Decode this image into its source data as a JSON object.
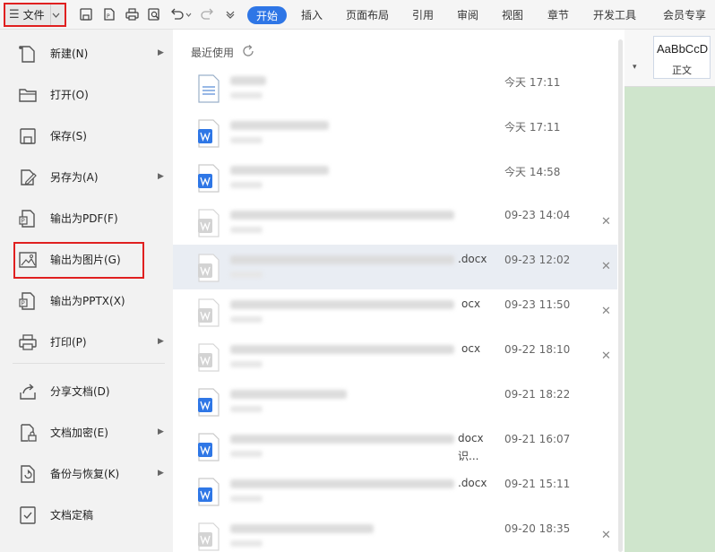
{
  "toolbar": {
    "file_label": "文件",
    "tabs": [
      {
        "label": "开始",
        "active": true
      },
      {
        "label": "插入"
      },
      {
        "label": "页面布局"
      },
      {
        "label": "引用"
      },
      {
        "label": "审阅"
      },
      {
        "label": "视图"
      },
      {
        "label": "章节"
      },
      {
        "label": "开发工具"
      },
      {
        "label": "会员专享"
      }
    ],
    "accent_color": "#2e76e6",
    "quick_access_icons": [
      "save-icon",
      "export-pdf-icon",
      "print-icon",
      "print-preview-icon",
      "undo-icon",
      "redo-icon",
      "more-icon"
    ]
  },
  "style_gallery": {
    "sample": "AaBbCcD",
    "name": "正文"
  },
  "file_menu": {
    "items": [
      {
        "label": "新建(N)",
        "icon": "new-icon",
        "submenu": true
      },
      {
        "label": "打开(O)",
        "icon": "folder-icon",
        "submenu": false
      },
      {
        "label": "保存(S)",
        "icon": "save-icon",
        "submenu": false
      },
      {
        "label": "另存为(A)",
        "icon": "save-as-icon",
        "submenu": true
      },
      {
        "label": "输出为PDF(F)",
        "icon": "export-pdf-icon",
        "submenu": false
      },
      {
        "label": "输出为图片(G)",
        "icon": "image-icon",
        "submenu": false,
        "highlighted": true
      },
      {
        "label": "输出为PPTX(X)",
        "icon": "export-pptx-icon",
        "submenu": false
      },
      {
        "label": "打印(P)",
        "icon": "print-icon",
        "submenu": true
      },
      {
        "label": "分享文档(D)",
        "icon": "share-icon",
        "submenu": false
      },
      {
        "label": "文档加密(E)",
        "icon": "lock-document-icon",
        "submenu": true
      },
      {
        "label": "备份与恢复(K)",
        "icon": "backup-icon",
        "submenu": true
      },
      {
        "label": "文档定稿",
        "icon": "finalize-icon",
        "submenu": false
      }
    ]
  },
  "recent": {
    "title": "最近使用",
    "files": [
      {
        "type": "txt",
        "name_suffix": "",
        "sub": "",
        "time": "今天  17:11",
        "closable": false
      },
      {
        "type": "word",
        "name_suffix": "",
        "sub": "",
        "time": "今天  17:11",
        "closable": false
      },
      {
        "type": "word",
        "name_suffix": "",
        "sub": "",
        "time": "今天  14:58",
        "closable": false
      },
      {
        "type": "word-gray",
        "name_suffix": "",
        "sub": "",
        "time": "09-23 14:04",
        "closable": true
      },
      {
        "type": "word-gray",
        "name_suffix": ".docx",
        "sub": "",
        "time": "09-23 12:02",
        "closable": true,
        "selected": true
      },
      {
        "type": "word-gray",
        "name_suffix": "ocx",
        "sub": "",
        "time": "09-23 11:50",
        "closable": true
      },
      {
        "type": "word-gray",
        "name_suffix": "ocx",
        "sub": "",
        "time": "09-22 18:10",
        "closable": true
      },
      {
        "type": "word",
        "name_suffix": "",
        "sub": "",
        "time": "09-21 18:22",
        "closable": false
      },
      {
        "type": "word",
        "name_suffix": "docx",
        "sub": "识...",
        "time": "09-21 16:07",
        "closable": false
      },
      {
        "type": "word",
        "name_suffix": ".docx",
        "sub": "",
        "time": "09-21 15:11",
        "closable": false
      },
      {
        "type": "word-gray",
        "name_suffix": "",
        "sub": "",
        "time": "09-20 18:35",
        "closable": true
      }
    ]
  }
}
